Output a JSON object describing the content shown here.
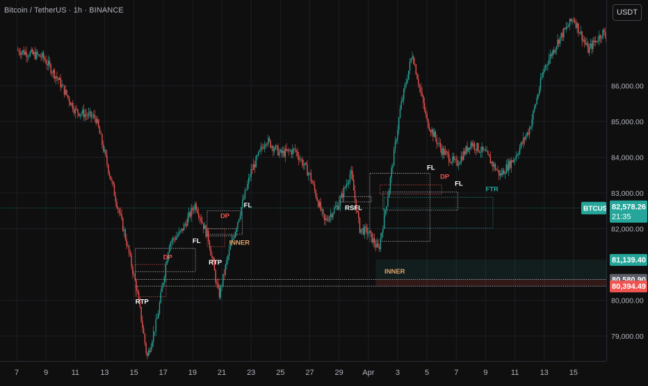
{
  "header": {
    "title": "Bitcoin / TetherUS · 1h · BINANCE",
    "currency_button": "USDT"
  },
  "colors": {
    "background": "#0f0f0f",
    "up": "#26a69a",
    "down": "#ef5350",
    "grid": "#1c1f26",
    "label_white": "#ffffff",
    "label_red": "#ef5350",
    "label_orange": "#e0a46c",
    "label_teal": "#26a69a"
  },
  "chart_data": {
    "type": "candlestick",
    "symbol": "BTCUSDT",
    "interval": "1h",
    "exchange": "BINANCE",
    "ylim": [
      78300,
      88400
    ],
    "y_ticks": [
      79000,
      80000,
      82000,
      83000,
      84000,
      85000,
      86000
    ],
    "y_tick_labels": [
      "79,000.00",
      "80,000.00",
      "82,000.00",
      "83,000.00",
      "84,000.00",
      "85,000.00",
      "86,000.00"
    ],
    "x_ticks": [
      "7",
      "9",
      "11",
      "13",
      "15",
      "17",
      "19",
      "21",
      "23",
      "25",
      "27",
      "29",
      "Apr",
      "3",
      "5",
      "7",
      "9",
      "11",
      "13",
      "15"
    ],
    "price_path": [
      [
        0,
        87000
      ],
      [
        0.9,
        86800
      ],
      [
        1.4,
        86200
      ],
      [
        2.0,
        85300
      ],
      [
        2.7,
        85100
      ],
      [
        3.3,
        83100
      ],
      [
        3.7,
        81800
      ],
      [
        4.1,
        80300
      ],
      [
        4.45,
        78400
      ],
      [
        4.8,
        79500
      ],
      [
        5.2,
        81600
      ],
      [
        5.6,
        81900
      ],
      [
        6.1,
        82700
      ],
      [
        6.55,
        81700
      ],
      [
        6.9,
        80100
      ],
      [
        7.2,
        81200
      ],
      [
        7.6,
        82400
      ],
      [
        8.0,
        83600
      ],
      [
        8.5,
        84500
      ],
      [
        9.0,
        84100
      ],
      [
        9.5,
        84200
      ],
      [
        10.0,
        83500
      ],
      [
        10.5,
        82200
      ],
      [
        11.0,
        82700
      ],
      [
        11.4,
        83600
      ],
      [
        11.7,
        82000
      ],
      [
        12.0,
        81900
      ],
      [
        12.35,
        81400
      ],
      [
        12.7,
        83100
      ],
      [
        13.1,
        85400
      ],
      [
        13.5,
        86900
      ],
      [
        14.0,
        85000
      ],
      [
        14.5,
        84200
      ],
      [
        15.0,
        83800
      ],
      [
        15.5,
        84400
      ],
      [
        16.0,
        84100
      ],
      [
        16.5,
        83500
      ],
      [
        17.0,
        84000
      ],
      [
        17.5,
        84800
      ],
      [
        18.0,
        86500
      ],
      [
        18.5,
        87300
      ],
      [
        19.0,
        87900
      ],
      [
        19.5,
        87000
      ],
      [
        20.0,
        87500
      ],
      [
        20.5,
        86800
      ],
      [
        21.0,
        86600
      ],
      [
        21.5,
        87800
      ],
      [
        22.0,
        87400
      ],
      [
        22.4,
        86100
      ],
      [
        22.8,
        85200
      ],
      [
        23.2,
        84200
      ],
      [
        23.6,
        83800
      ],
      [
        24.0,
        82400
      ],
      [
        24.3,
        81700
      ],
      [
        24.6,
        82800
      ],
      [
        24.9,
        83300
      ],
      [
        25.2,
        82200
      ],
      [
        25.5,
        81600
      ],
      [
        25.7,
        82300
      ]
    ],
    "last_price": "82,578.26",
    "countdown": "21:35",
    "price_tags": [
      {
        "id": "tag_81139",
        "label": "81,139.40",
        "price": 81139.4
      },
      {
        "id": "tag_80580",
        "label": "80,580.90",
        "price": 80580.9
      },
      {
        "id": "tag_80394",
        "label": "80,394.49",
        "price": 80394.49
      }
    ],
    "zones": [
      {
        "kind": "box",
        "x": [
          4.05,
          6.1
        ],
        "y": [
          80800,
          81450
        ],
        "style": "white-dotted"
      },
      {
        "kind": "box",
        "x": [
          4.05,
          5.1
        ],
        "y": [
          80100,
          81000
        ],
        "style": "red-dotted"
      },
      {
        "kind": "box",
        "x": [
          6.5,
          7.7
        ],
        "y": [
          81850,
          82500
        ],
        "style": "white-dotted"
      },
      {
        "kind": "box",
        "x": [
          6.5,
          7.1
        ],
        "y": [
          81500,
          82000
        ],
        "style": "red-dotted"
      },
      {
        "kind": "box",
        "x": [
          6.5,
          7.5
        ],
        "y": [
          81800,
          82000
        ],
        "style": "white-dotted"
      },
      {
        "kind": "box",
        "x": [
          11.0,
          12.1
        ],
        "y": [
          82750,
          82900
        ],
        "style": "white-dotted"
      },
      {
        "kind": "box",
        "x": [
          12.05,
          14.1
        ],
        "y": [
          81650,
          83550
        ],
        "style": "white-dotted"
      },
      {
        "kind": "box",
        "x": [
          12.4,
          14.5
        ],
        "y": [
          82970,
          83230
        ],
        "style": "red-dotted"
      },
      {
        "kind": "box",
        "x": [
          12.5,
          15.05
        ],
        "y": [
          82520,
          83030
        ],
        "style": "white-dotted"
      },
      {
        "kind": "box",
        "x": [
          12.55,
          16.25
        ],
        "y": [
          82020,
          82880
        ],
        "style": "teal-dotted"
      },
      {
        "kind": "fill",
        "x": [
          12.25,
          20.9
        ],
        "y": [
          80580,
          81139
        ],
        "style": "teal-fill"
      },
      {
        "kind": "hline",
        "x": [
          4.05,
          20.9
        ],
        "y": 80580.9,
        "style": "white-dotted"
      },
      {
        "kind": "hline",
        "x": [
          4.05,
          20.9
        ],
        "y": 80394.49,
        "style": "white-dotted"
      },
      {
        "kind": "fill",
        "x": [
          12.25,
          20.9
        ],
        "y": [
          80400,
          80580
        ],
        "style": "red-fill"
      }
    ],
    "annotations": [
      {
        "text": "RTP",
        "x": 4.05,
        "y": 79900,
        "color": "white"
      },
      {
        "text": "DP",
        "x": 5.0,
        "y": 81150,
        "color": "red"
      },
      {
        "text": "FL",
        "x": 6.0,
        "y": 81600,
        "color": "white"
      },
      {
        "text": "RTP",
        "x": 6.55,
        "y": 81000,
        "color": "white"
      },
      {
        "text": "DP",
        "x": 6.95,
        "y": 82300,
        "color": "red"
      },
      {
        "text": "FL",
        "x": 7.75,
        "y": 82600,
        "color": "white"
      },
      {
        "text": "INNER",
        "x": 7.25,
        "y": 81550,
        "color": "orange"
      },
      {
        "text": "RSFL",
        "x": 11.2,
        "y": 82520,
        "color": "white"
      },
      {
        "text": "FL",
        "x": 14.0,
        "y": 83650,
        "color": "white"
      },
      {
        "text": "DP",
        "x": 14.45,
        "y": 83400,
        "color": "red"
      },
      {
        "text": "FL",
        "x": 14.95,
        "y": 83200,
        "color": "white"
      },
      {
        "text": "FTR",
        "x": 16.0,
        "y": 83050,
        "color": "teal"
      },
      {
        "text": "INNER",
        "x": 12.55,
        "y": 80750,
        "color": "orange"
      }
    ]
  }
}
